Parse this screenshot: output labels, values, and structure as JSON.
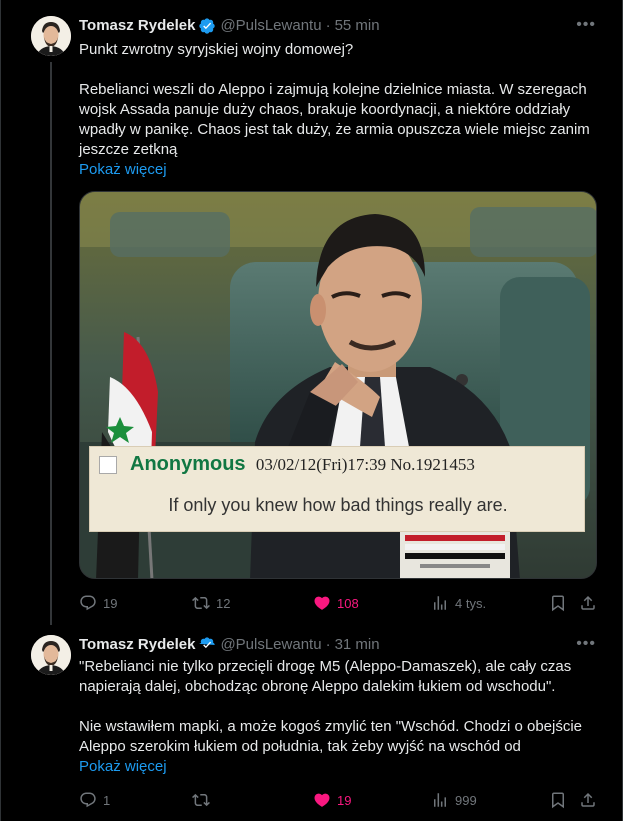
{
  "tweets": [
    {
      "author_name": "Tomasz Rydelek",
      "handle": "@PulsLewantu",
      "separator": "·",
      "time": "55 min",
      "lines": [
        "Punkt zwrotny syryjskiej wojny domowej?",
        "Rebelianci weszli do Aleppo i zajmują kolejne dzielnice miasta. W szeregach wojsk Assada panuje duży chaos, brakuje koordynacji, a niektóre oddziały wpadły w panikę. Chaos jest tak duży, że armia opuszcza wiele miejsc zanim jeszcze zetkną"
      ],
      "show_more": "Pokaż więcej",
      "image": {
        "caption_name": "Anonymous",
        "caption_meta": "03/02/12(Fri)17:39 No.1921453",
        "caption_quote": "If only you knew how bad things really are."
      },
      "stats": {
        "replies": "19",
        "reposts": "12",
        "likes": "108",
        "views": "4 tys."
      }
    },
    {
      "author_name": "Tomasz Rydelek",
      "handle": "@PulsLewantu",
      "separator": "·",
      "time": "31 min",
      "lines": [
        "\"Rebelianci nie tylko przecięli drogę M5 (Aleppo-Damaszek), ale cały czas napierają dalej, obchodząc obronę Aleppo dalekim łukiem od wschodu\".",
        "Nie wstawiłem mapki, a może kogoś zmylić ten \"Wschód. Chodzi o obejście Aleppo szerokim łukiem od południa, tak żeby wyjść na wschód od"
      ],
      "show_more": "Pokaż więcej",
      "stats": {
        "replies": "1",
        "reposts": "",
        "likes": "19",
        "views": "999"
      }
    }
  ],
  "icons": {
    "verified": "verified-badge-icon",
    "more": "more-icon",
    "reply": "reply-icon",
    "repost": "repost-icon",
    "like": "heart-icon",
    "views": "views-icon",
    "bookmark": "bookmark-icon",
    "share": "share-icon"
  },
  "colors": {
    "background": "#000000",
    "text": "#e7e9ea",
    "muted": "#71767b",
    "link": "#1d9bf0",
    "like": "#f91880",
    "verified": "#1d9bf0"
  }
}
